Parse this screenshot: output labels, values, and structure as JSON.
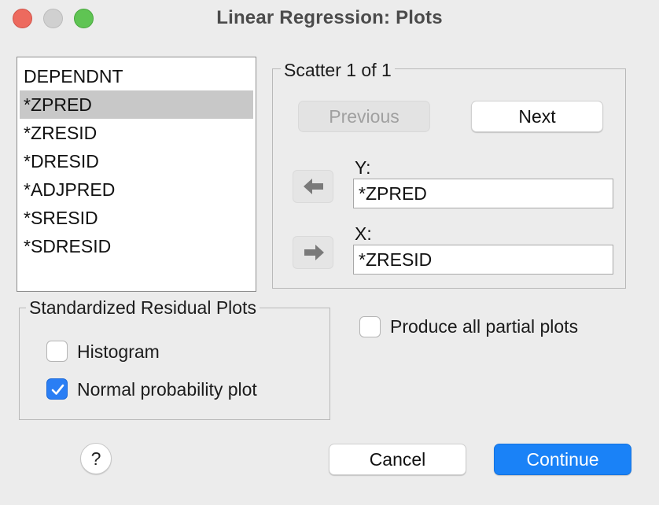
{
  "window": {
    "title": "Linear Regression: Plots"
  },
  "variables": {
    "items": [
      {
        "label": "DEPENDNT",
        "selected": false
      },
      {
        "label": "*ZPRED",
        "selected": true
      },
      {
        "label": "*ZRESID",
        "selected": false
      },
      {
        "label": "*DRESID",
        "selected": false
      },
      {
        "label": "*ADJPRED",
        "selected": false
      },
      {
        "label": "*SRESID",
        "selected": false
      },
      {
        "label": "*SDRESID",
        "selected": false
      }
    ]
  },
  "scatter": {
    "legend": "Scatter 1 of 1",
    "previous_label": "Previous",
    "next_label": "Next",
    "y_label": "Y:",
    "y_value": "*ZPRED",
    "x_label": "X:",
    "x_value": "*ZRESID"
  },
  "standardized": {
    "legend": "Standardized Residual Plots",
    "histogram_label": "Histogram",
    "histogram_checked": false,
    "normal_prob_label": "Normal probability plot",
    "normal_prob_checked": true
  },
  "partial": {
    "label": "Produce all partial plots",
    "checked": false
  },
  "footer": {
    "help_label": "?",
    "cancel_label": "Cancel",
    "continue_label": "Continue"
  },
  "colors": {
    "accent": "#1a82f7",
    "selection": "#c8c8c8"
  }
}
